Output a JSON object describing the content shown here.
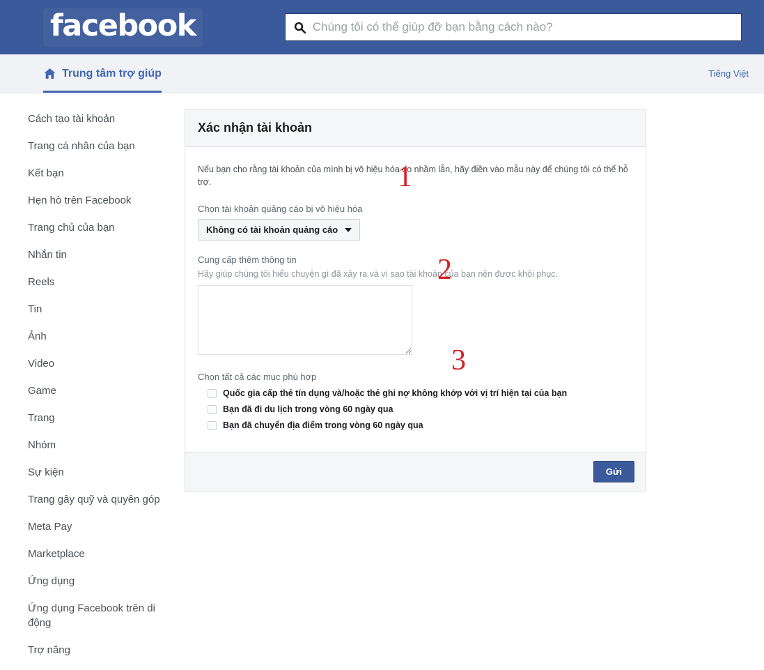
{
  "header": {
    "logo_text": "facebook",
    "logo_icon": "facebook-wordmark",
    "search": {
      "icon": "search-icon",
      "placeholder": "Chúng tôi có thể giúp đỡ bạn bằng cách nào?",
      "value": ""
    },
    "background_color": "#3b5a9b"
  },
  "subnav": {
    "home_icon": "home-icon",
    "help_center_label": "Trung tâm trợ giúp",
    "language_label": "Tiếng Việt",
    "accent_color": "#4267b2"
  },
  "sidebar": {
    "items": [
      {
        "label": "Cách tạo tài khoản"
      },
      {
        "label": "Trang cá nhân của bạn"
      },
      {
        "label": "Kết bạn"
      },
      {
        "label": "Hẹn hò trên Facebook"
      },
      {
        "label": "Trang chủ của bạn"
      },
      {
        "label": "Nhắn tin"
      },
      {
        "label": "Reels"
      },
      {
        "label": "Tin"
      },
      {
        "label": "Ảnh"
      },
      {
        "label": "Video"
      },
      {
        "label": "Game"
      },
      {
        "label": "Trang"
      },
      {
        "label": "Nhóm"
      },
      {
        "label": "Sự kiện"
      },
      {
        "label": "Trang gây quỹ và quyên góp"
      },
      {
        "label": "Meta Pay"
      },
      {
        "label": "Marketplace"
      },
      {
        "label": "Ứng dụng"
      },
      {
        "label": "Ứng dụng Facebook trên di động"
      },
      {
        "label": "Trợ năng"
      }
    ]
  },
  "card": {
    "title": "Xác nhận tài khoản",
    "intro": "Nếu bạn cho rằng tài khoản của mình bị vô hiệu hóa do nhầm lẫn, hãy điền vào mẫu này để chúng tôi có thể hỗ trợ.",
    "ad_account": {
      "label": "Chọn tài khoản quảng cáo bị vô hiệu hóa",
      "selected_option": "Không có tài khoản quảng cáo",
      "caret_icon": "chevron-down-icon"
    },
    "more_info": {
      "label": "Cung cấp thêm thông tin",
      "help": "Hãy giúp chúng tôi hiểu chuyện gì đã xảy ra và vì sao tài khoản của bạn nên được khôi phục.",
      "value": "",
      "placeholder": ""
    },
    "checkboxes": {
      "group_label": "Chọn tất cả các mục phù hợp",
      "items": [
        {
          "label": "Quốc gia cấp thẻ tín dụng và/hoặc thẻ ghi nợ không khớp với vị trí hiện tại của bạn",
          "checked": false
        },
        {
          "label": "Bạn đã đi du lịch trong vòng 60 ngày qua",
          "checked": false
        },
        {
          "label": "Bạn đã chuyển địa điểm trong vòng 60 ngày qua",
          "checked": false
        }
      ]
    },
    "submit_label": "Gửi",
    "submit_color": "#3b5a9b"
  },
  "annotations": {
    "color": "#d42027",
    "one": "1",
    "two": "2",
    "three": "3"
  }
}
